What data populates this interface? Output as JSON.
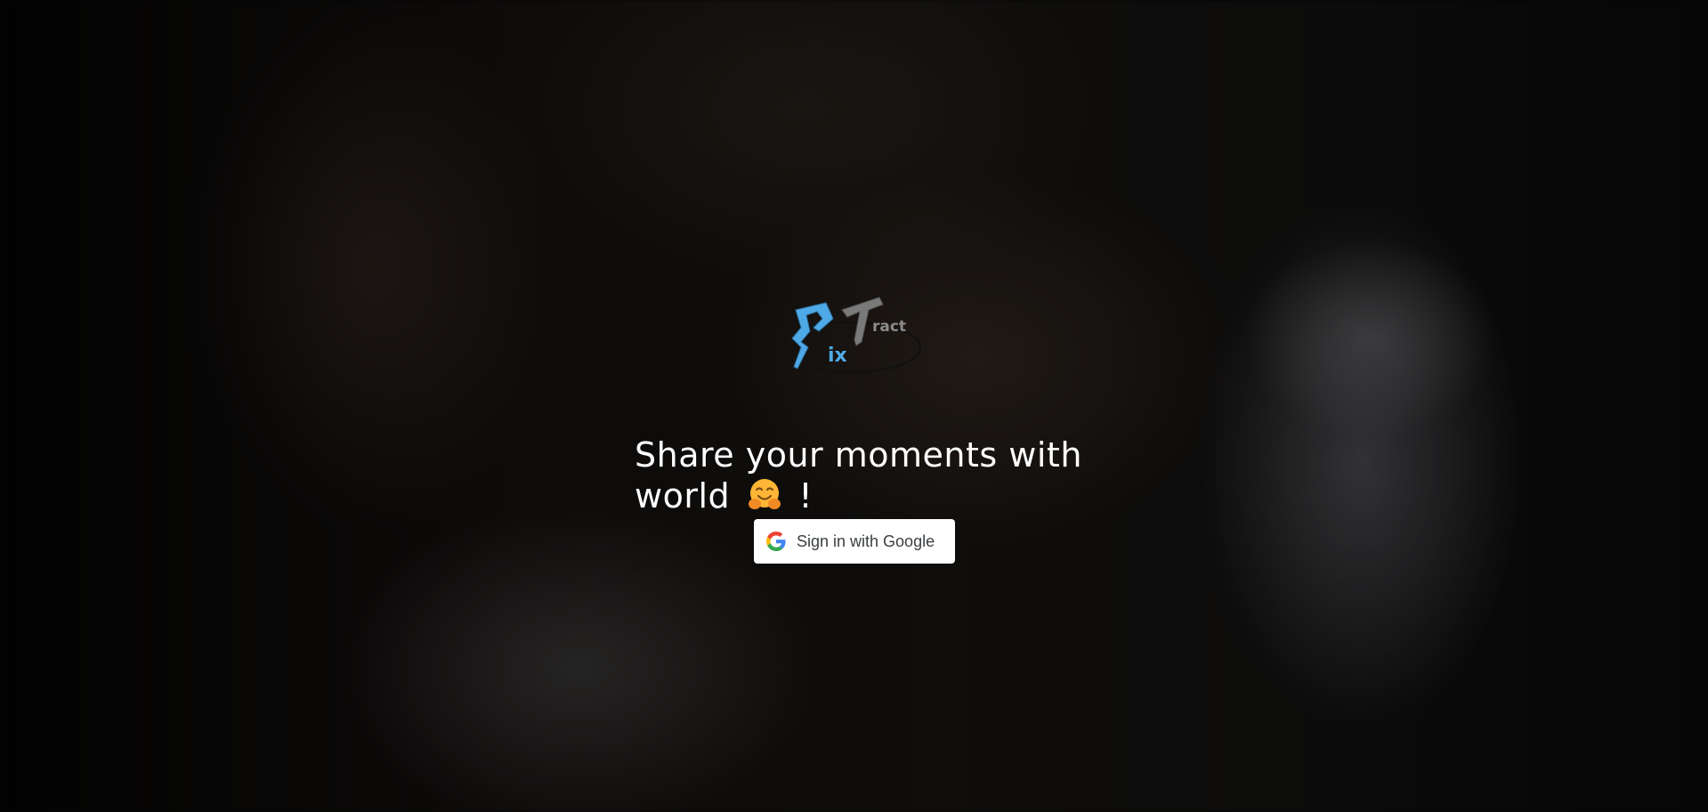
{
  "page": {
    "logo_text": "PixTract"
  },
  "hero": {
    "headline_line1": "Share your moments with",
    "headline_line2_word": "world",
    "headline_emoji": "hugging-face-emoji",
    "headline_end": "!"
  },
  "auth": {
    "google_button_label": "Sign in with Google",
    "google_icon": "google-g-icon"
  },
  "colors": {
    "logo_blue": "#4fa9e6",
    "logo_gray": "#7a7a7a",
    "text": "#ffffff",
    "button_bg": "#ffffff",
    "button_text": "#3c4043"
  }
}
